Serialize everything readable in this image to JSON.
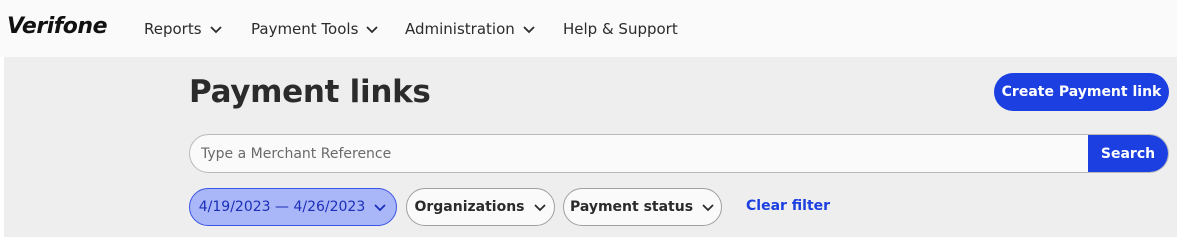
{
  "brand": {
    "logo_text": "Verifone"
  },
  "nav": {
    "items": [
      {
        "label": "Reports",
        "has_dropdown": true
      },
      {
        "label": "Payment Tools",
        "has_dropdown": true
      },
      {
        "label": "Administration",
        "has_dropdown": true
      },
      {
        "label": "Help & Support",
        "has_dropdown": false
      }
    ]
  },
  "page": {
    "title": "Payment links",
    "create_button_label": "Create Payment link"
  },
  "search": {
    "placeholder": "Type a Merchant Reference",
    "value": "",
    "button_label": "Search"
  },
  "filters": {
    "date_range": "4/19/2023 — 4/26/2023",
    "organizations_label": "Organizations",
    "payment_status_label": "Payment status",
    "clear_label": "Clear filter"
  },
  "colors": {
    "accent": "#1b3fe0",
    "date_chip_bg": "#a9b6f8",
    "page_bg": "#eeeeee",
    "topbar_bg": "#fafafa"
  },
  "icons": {
    "dropdown": "chevron-down-icon"
  }
}
